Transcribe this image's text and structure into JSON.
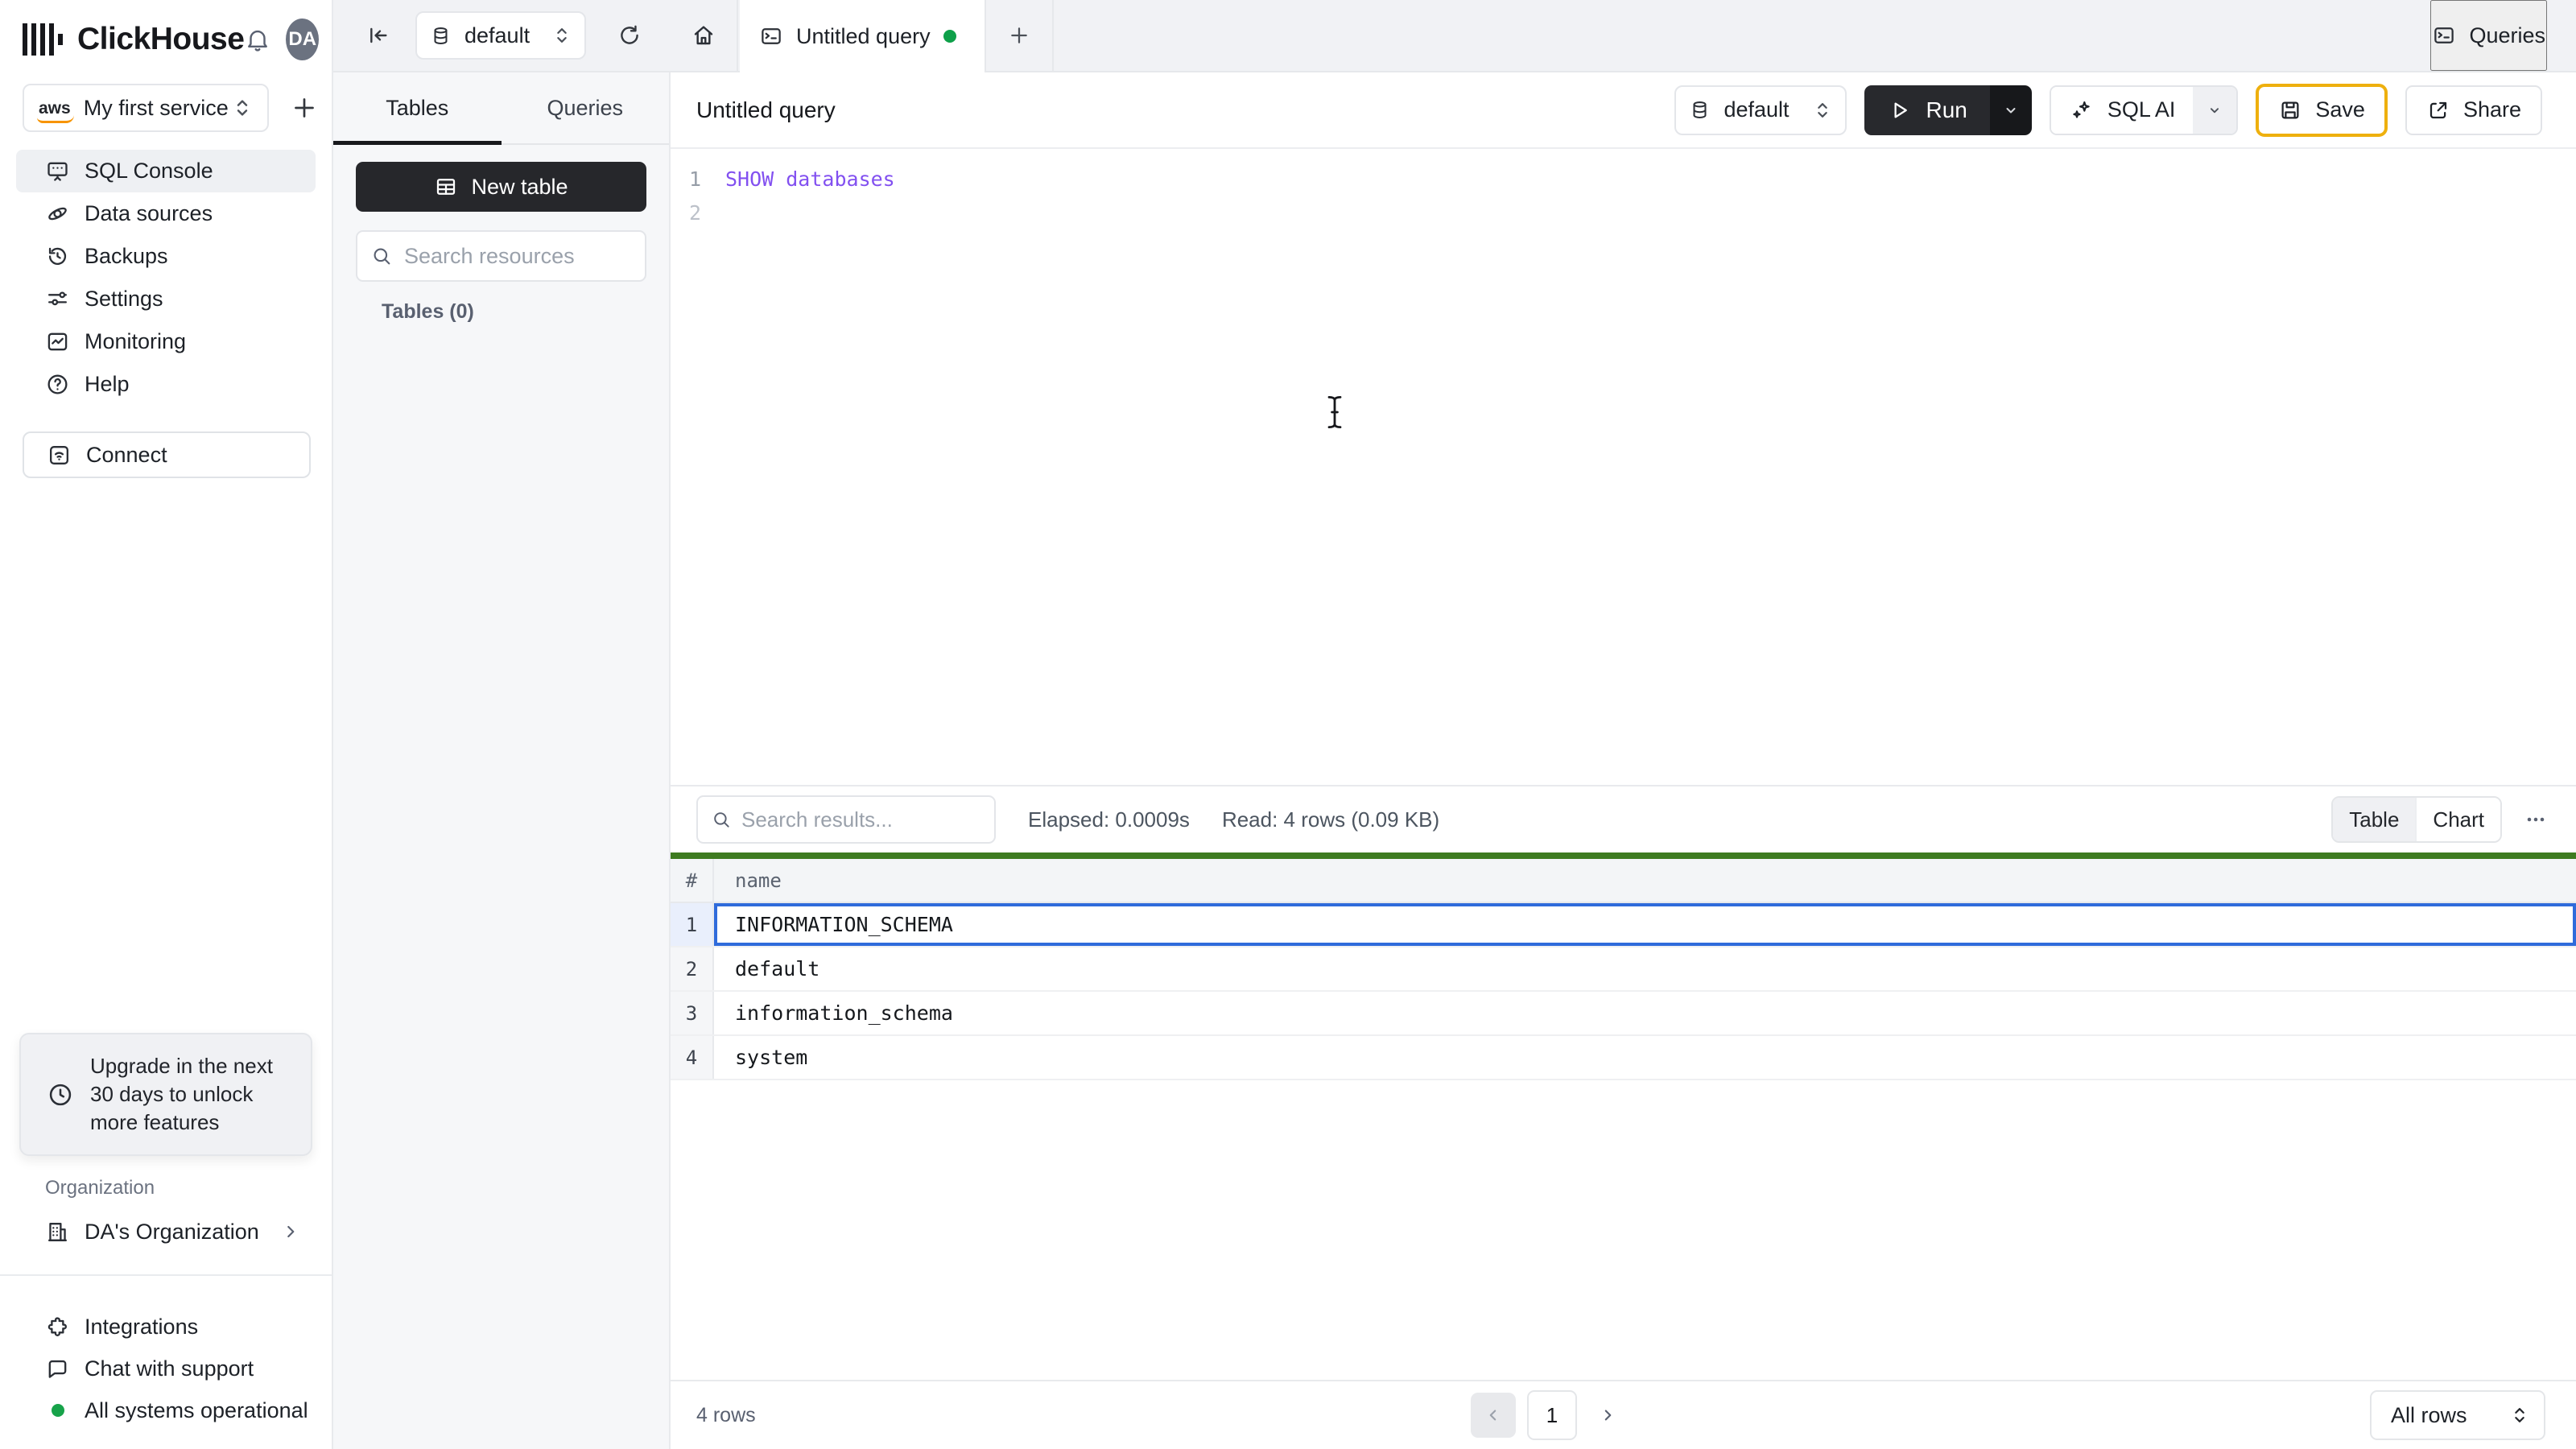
{
  "brand": {
    "name": "ClickHouse",
    "avatar_initials": "DA"
  },
  "service_selector": {
    "label": "My first service",
    "provider": "aws"
  },
  "sidebar": {
    "items": [
      {
        "label": "SQL Console"
      },
      {
        "label": "Data sources"
      },
      {
        "label": "Backups"
      },
      {
        "label": "Settings"
      },
      {
        "label": "Monitoring"
      },
      {
        "label": "Help"
      }
    ],
    "connect_label": "Connect",
    "upgrade_notice": "Upgrade in the next 30 days to unlock more features",
    "organization_label": "Organization",
    "organization_name": "DA's Organization",
    "integrations_label": "Integrations",
    "chat_label": "Chat with support",
    "status_label": "All systems operational"
  },
  "resource_panel": {
    "database_selector": "default",
    "tab_tables": "Tables",
    "tab_queries": "Queries",
    "new_table_label": "New table",
    "search_placeholder": "Search resources",
    "tables_count": "Tables (0)"
  },
  "topbar": {
    "tab_title": "Untitled query",
    "queries_button": "Queries"
  },
  "editor": {
    "title": "Untitled query",
    "database_selector": "default",
    "run_label": "Run",
    "sql_ai_label": "SQL AI",
    "save_label": "Save",
    "share_label": "Share",
    "line1_number": "1",
    "line1_code": "SHOW databases",
    "line2_number": "2"
  },
  "results": {
    "search_placeholder": "Search results...",
    "elapsed": "Elapsed: 0.0009s",
    "read": "Read: 4 rows (0.09 KB)",
    "toggle_table": "Table",
    "toggle_chart": "Chart",
    "col_hash": "#",
    "col_name": "name",
    "rows": [
      {
        "num": "1",
        "name": "INFORMATION_SCHEMA"
      },
      {
        "num": "2",
        "name": "default"
      },
      {
        "num": "3",
        "name": "information_schema"
      },
      {
        "num": "4",
        "name": "system"
      }
    ],
    "rows_count": "4 rows",
    "page": "1",
    "page_size": "All rows"
  },
  "colors": {
    "accent_green_bar": "#3e7b20",
    "selection_blue": "#2f6bdb",
    "save_border_gold": "#eeb00e",
    "status_green": "#17a34a",
    "tab_dot_green": "#0ea049",
    "keyword_purple": "#8250f0"
  }
}
